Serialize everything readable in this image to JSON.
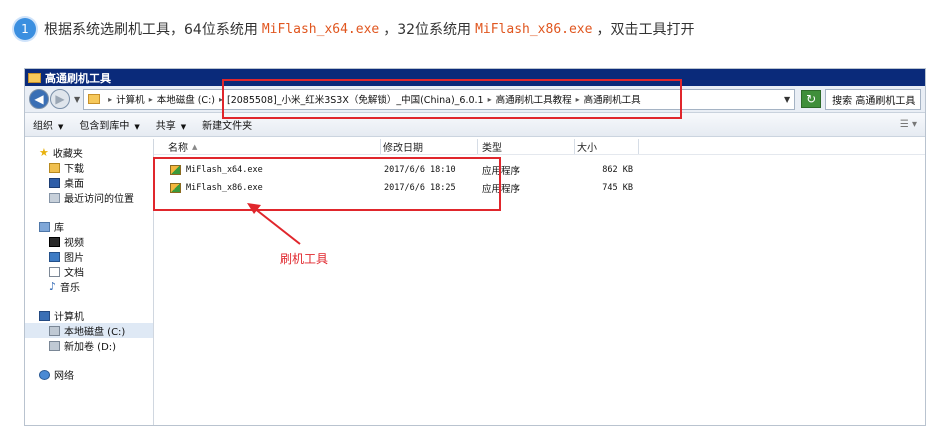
{
  "instruction": {
    "step_number": "1",
    "text_before": "根据系统选刷机工具，64位系统用",
    "file_64": "MiFlash_x64.exe",
    "text_middle": "，32位系统用",
    "file_86": "MiFlash_x86.exe",
    "text_after": "，双击工具打开"
  },
  "window": {
    "title": "高通刷机工具",
    "address": {
      "crumbs": [
        "计算机",
        "本地磁盘 (C:)",
        "[2085508]_小米_红米3S3X（免解锁）_中国(China)_6.0.1",
        "高通刷机工具教程",
        "高通刷机工具"
      ]
    },
    "search_placeholder": "搜索 高通刷机工具",
    "toolbar": {
      "organize": "组织",
      "include_library": "包含到库中",
      "share": "共享",
      "new_folder": "新建文件夹"
    },
    "nav": {
      "favorites": "收藏夹",
      "downloads": "下载",
      "desktop": "桌面",
      "recent": "最近访问的位置",
      "libraries": "库",
      "videos": "视频",
      "pictures": "图片",
      "documents": "文档",
      "music": "音乐",
      "computer": "计算机",
      "local_disk": "本地磁盘 (C:)",
      "new_volume": "新加卷 (D:)",
      "network": "网络"
    },
    "columns": {
      "name": "名称",
      "modified": "修改日期",
      "type": "类型",
      "size": "大小"
    },
    "files": [
      {
        "name": "MiFlash_x64.exe",
        "modified": "2017/6/6 18:10",
        "type": "应用程序",
        "size": "862 KB"
      },
      {
        "name": "MiFlash_x86.exe",
        "modified": "2017/6/6 18:25",
        "type": "应用程序",
        "size": "745 KB"
      }
    ]
  },
  "annotation": {
    "label": "刷机工具",
    "color": "#e0262c"
  }
}
